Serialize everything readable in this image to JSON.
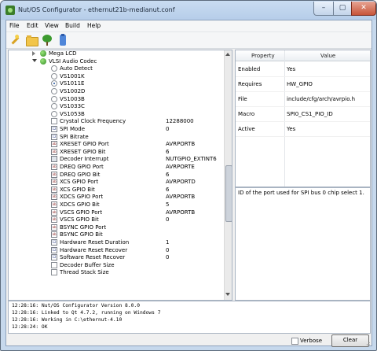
{
  "window": {
    "title": "Nut/OS Configurator - ethernut21b-medianut.conf",
    "min_glyph": "–",
    "max_glyph": "▢",
    "close_glyph": "✕"
  },
  "menu": [
    "File",
    "Edit",
    "View",
    "Build",
    "Help"
  ],
  "toolbar_icons": [
    "wand-icon",
    "folder-icon",
    "tree-icon",
    "bottle-icon"
  ],
  "tree": [
    {
      "label": "Mega LCD",
      "icon": "ball",
      "indent": 1,
      "value": ""
    },
    {
      "label": "VLSI Audio Codec",
      "icon": "ball",
      "indent": 1,
      "expanded": true,
      "value": ""
    },
    {
      "label": "Auto Detect",
      "icon": "radio",
      "indent": 2,
      "value": ""
    },
    {
      "label": "VS1001K",
      "icon": "radio",
      "indent": 2,
      "value": ""
    },
    {
      "label": "VS1011E",
      "icon": "radio-on",
      "indent": 2,
      "value": ""
    },
    {
      "label": "VS1002D",
      "icon": "radio",
      "indent": 2,
      "value": ""
    },
    {
      "label": "VS1003B",
      "icon": "radio",
      "indent": 2,
      "value": ""
    },
    {
      "label": "VS1033C",
      "icon": "radio",
      "indent": 2,
      "value": ""
    },
    {
      "label": "VS1053B",
      "icon": "radio",
      "indent": 2,
      "value": ""
    },
    {
      "label": "Crystal Clock Frequency",
      "icon": "check",
      "indent": 2,
      "value": "12288000"
    },
    {
      "label": "SPI Mode",
      "icon": "num",
      "indent": 2,
      "value": "0"
    },
    {
      "label": "SPI Bitrate",
      "icon": "num",
      "indent": 2,
      "value": ""
    },
    {
      "label": "XRESET GPIO Port",
      "icon": "text",
      "indent": 2,
      "value": "AVRPORTB"
    },
    {
      "label": "XRESET GPIO Bit",
      "icon": "text",
      "indent": 2,
      "value": "6"
    },
    {
      "label": "Decoder Interrupt",
      "icon": "key",
      "indent": 2,
      "value": "NUTGPIO_EXTINT6"
    },
    {
      "label": "DREQ GPIO Port",
      "icon": "text",
      "indent": 2,
      "value": "AVRPORTE"
    },
    {
      "label": "DREQ GPIO Bit",
      "icon": "text",
      "indent": 2,
      "value": "6"
    },
    {
      "label": "XCS GPIO Port",
      "icon": "text",
      "indent": 2,
      "value": "AVRPORTD"
    },
    {
      "label": "XCS GPIO Bit",
      "icon": "text",
      "indent": 2,
      "value": "6"
    },
    {
      "label": "XDCS GPIO Port",
      "icon": "text",
      "indent": 2,
      "value": "AVRPORTB"
    },
    {
      "label": "XDCS GPIO Bit",
      "icon": "text",
      "indent": 2,
      "value": "5"
    },
    {
      "label": "VSCS GPIO Port",
      "icon": "text",
      "indent": 2,
      "value": "AVRPORTB"
    },
    {
      "label": "VSCS GPIO Bit",
      "icon": "text",
      "indent": 2,
      "value": "0"
    },
    {
      "label": "BSYNC GPIO Port",
      "icon": "text",
      "indent": 2,
      "value": ""
    },
    {
      "label": "BSYNC GPIO Bit",
      "icon": "text",
      "indent": 2,
      "value": ""
    },
    {
      "label": "Hardware Reset Duration",
      "icon": "num",
      "indent": 2,
      "value": "1"
    },
    {
      "label": "Hardware Reset Recover",
      "icon": "num",
      "indent": 2,
      "value": "0"
    },
    {
      "label": "Software Reset Recover",
      "icon": "num",
      "indent": 2,
      "value": "0"
    },
    {
      "label": "Decoder Buffer Size",
      "icon": "check",
      "indent": 2,
      "value": ""
    },
    {
      "label": "Thread Stack Size",
      "icon": "check",
      "indent": 2,
      "value": ""
    }
  ],
  "properties": {
    "headers": [
      "Property",
      "Value"
    ],
    "rows": [
      {
        "key": "Enabled",
        "value": "Yes"
      },
      {
        "key": "Requires",
        "value": "HW_GPIO"
      },
      {
        "key": "File",
        "value": "include/cfg/arch/avrpio.h"
      },
      {
        "key": "Macro",
        "value": "SPI0_CS1_PIO_ID"
      },
      {
        "key": "Active",
        "value": "Yes"
      }
    ]
  },
  "description": "ID of the port used for SPI bus 0 chip select 1.",
  "log": [
    "12:28:16: Nut/OS Configurator Version 8.0.0",
    "12:28:16: Linked to Qt 4.7.2, running on Windows 7",
    "12:28:16: Working in C:\\ethernut-4.10",
    "12:28:24: OK"
  ],
  "bottom": {
    "verbose_label": "Verbose",
    "verbose_checked": false,
    "clear_label": "Clear"
  },
  "colors": {
    "selection": "#cfe3f8",
    "frame": "#c6d8ec"
  }
}
